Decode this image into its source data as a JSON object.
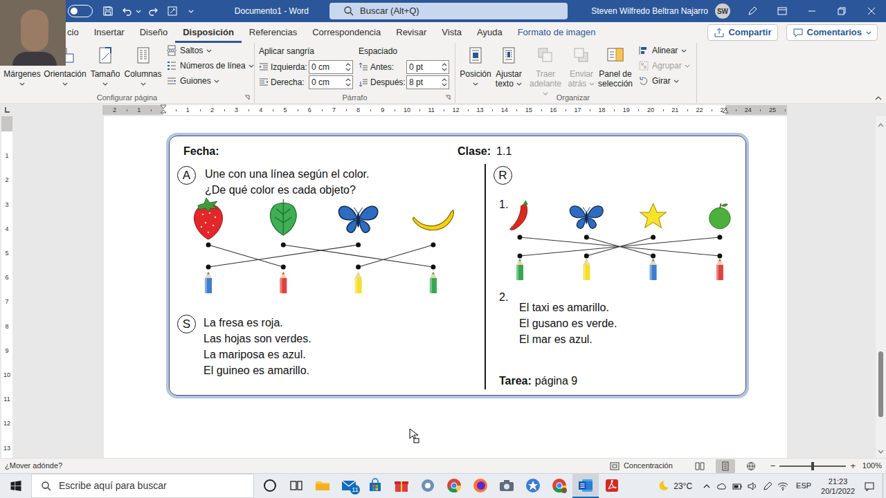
{
  "title_bar": {
    "autosave": {
      "on": false
    },
    "title": "Documento1 - Word",
    "search": {
      "placeholder": "Buscar (Alt+Q)"
    },
    "user": "Steven Wilfredo Beltran Najarro",
    "avatar": "SW"
  },
  "ribbon": {
    "tabs": [
      {
        "label": "cio",
        "selected": false,
        "contextual": false
      },
      {
        "label": "Insertar",
        "selected": false,
        "contextual": false
      },
      {
        "label": "Diseño",
        "selected": false,
        "contextual": false
      },
      {
        "label": "Disposición",
        "selected": true,
        "contextual": false
      },
      {
        "label": "Referencias",
        "selected": false,
        "contextual": false
      },
      {
        "label": "Correspondencia",
        "selected": false,
        "contextual": false
      },
      {
        "label": "Revisar",
        "selected": false,
        "contextual": false
      },
      {
        "label": "Vista",
        "selected": false,
        "contextual": false
      },
      {
        "label": "Ayuda",
        "selected": false,
        "contextual": false
      },
      {
        "label": "Formato de imagen",
        "selected": false,
        "contextual": true
      }
    ],
    "share": "Compartir",
    "comments": "Comentarios",
    "page_setup": {
      "title": "Configurar página",
      "large": [
        {
          "label": "Márgenes",
          "dropdown": true,
          "disabled": false
        },
        {
          "label": "Orientación",
          "dropdown": true,
          "disabled": false
        },
        {
          "label": "Tamaño",
          "dropdown": true,
          "disabled": false
        },
        {
          "label": "Columnas",
          "dropdown": true,
          "disabled": false
        }
      ],
      "small": [
        {
          "label": "Saltos",
          "dropdown": true,
          "disabled": false
        },
        {
          "label": "Números de línea",
          "dropdown": true,
          "disabled": false
        },
        {
          "label": "Guiones",
          "dropdown": true,
          "disabled": false
        }
      ]
    },
    "paragraph": {
      "title": "Párrafo",
      "indent": {
        "label": "Aplicar sangría",
        "fields": [
          {
            "label": "Izquierda:",
            "value": "0 cm"
          },
          {
            "label": "Derecha:",
            "value": "0 cm"
          }
        ]
      },
      "spacing": {
        "label": "Espaciado",
        "fields": [
          {
            "label": "Antes:",
            "value": "0 pt"
          },
          {
            "label": "Después:",
            "value": "8 pt"
          }
        ]
      }
    },
    "arrange": {
      "title": "Organizar",
      "large": [
        {
          "label": "Posición",
          "dropdown": true,
          "disabled": false
        },
        {
          "label": "Ajustar texto",
          "dropdown": true,
          "disabled": false
        },
        {
          "label": "Traer adelante",
          "dropdown": true,
          "disabled": true
        },
        {
          "label": "Enviar atrás",
          "dropdown": true,
          "disabled": true
        },
        {
          "label": "Panel de selección",
          "dropdown": false,
          "disabled": false
        }
      ],
      "small": [
        {
          "label": "Alinear",
          "dropdown": true,
          "disabled": false
        },
        {
          "label": "Agrupar",
          "dropdown": true,
          "disabled": true
        },
        {
          "label": "Girar",
          "dropdown": true,
          "disabled": false
        }
      ]
    }
  },
  "ruler": {
    "left": [
      "2",
      "1"
    ],
    "right": [
      "1",
      "2",
      "3",
      "4",
      "5",
      "6",
      "7",
      "8",
      "9",
      "10",
      "11",
      "12",
      "13",
      "14",
      "15",
      "16",
      "17",
      "18",
      "19",
      "20",
      "21",
      "22",
      "23",
      "24",
      "25"
    ],
    "vertical": [
      "1",
      "2",
      "3",
      "4",
      "5",
      "6",
      "7",
      "8",
      "9",
      "10",
      "11",
      "12",
      "13"
    ]
  },
  "worksheet": {
    "date_label": "Fecha:",
    "class_label": "Clase:",
    "class_value": "1.1",
    "a": {
      "badge": "A",
      "lines": [
        "Une con una línea según el color.",
        "¿De qué color es cada objeto?"
      ],
      "objects": [
        {
          "kind": "strawberry"
        },
        {
          "kind": "leaf"
        },
        {
          "kind": "butterfly"
        },
        {
          "kind": "banana"
        }
      ],
      "pencils": [
        {
          "color": "#3b7fd0"
        },
        {
          "color": "#e0423e"
        },
        {
          "color": "#f4e02c"
        },
        {
          "color": "#35a853"
        }
      ],
      "links": [
        [
          0,
          1
        ],
        [
          1,
          3
        ],
        [
          2,
          0
        ],
        [
          3,
          2
        ]
      ]
    },
    "s": {
      "badge": "S",
      "lines": [
        "La fresa es roja.",
        "Las hojas son verdes.",
        "La mariposa es azul.",
        "El guineo es amarillo."
      ]
    },
    "r": {
      "badge": "R",
      "number": "1.",
      "objects": [
        {
          "kind": "chili"
        },
        {
          "kind": "butterfly"
        },
        {
          "kind": "star"
        },
        {
          "kind": "apple"
        }
      ],
      "pencils": [
        {
          "color": "#35a853"
        },
        {
          "color": "#f4e02c"
        },
        {
          "color": "#3b7fd0"
        },
        {
          "color": "#e0423e"
        }
      ],
      "links": [
        [
          0,
          3
        ],
        [
          1,
          2
        ],
        [
          2,
          1
        ],
        [
          3,
          0
        ]
      ]
    },
    "r2": {
      "number": "2.",
      "lines": [
        "El taxi es amarillo.",
        "El gusano es verde.",
        "El mar es azul."
      ]
    },
    "homework": {
      "label": "Tarea:",
      "value": "página 9"
    }
  },
  "status_bar": {
    "message": "¿Mover adónde?",
    "focus": "Concentración",
    "views": [
      {
        "kind": "read",
        "selected": false
      },
      {
        "kind": "print",
        "selected": true
      },
      {
        "kind": "web",
        "selected": false
      }
    ],
    "zoom": {
      "minus": "−",
      "plus": "+",
      "level": 0.5,
      "reading": "100%"
    }
  },
  "taskbar": {
    "search": {
      "placeholder": "Escribe aquí para buscar"
    },
    "apps": [
      {
        "kind": "cortana",
        "active": false
      },
      {
        "kind": "task-view",
        "active": false
      },
      {
        "kind": "explorer",
        "active": false
      },
      {
        "kind": "mail",
        "active": false,
        "badge": "11"
      },
      {
        "kind": "store",
        "active": false
      },
      {
        "kind": "gift",
        "active": false
      },
      {
        "kind": "settings",
        "active": false
      },
      {
        "kind": "chrome",
        "active": false
      },
      {
        "kind": "firefox",
        "active": false
      },
      {
        "kind": "camera",
        "active": false
      },
      {
        "kind": "app",
        "active": false
      },
      {
        "kind": "chrome-profile",
        "active": false
      },
      {
        "kind": "word",
        "active": true
      },
      {
        "kind": "acrobat",
        "active": false
      }
    ],
    "weather": "23°C",
    "language": "ESP",
    "time": "21:23",
    "date": "20/1/2022"
  }
}
